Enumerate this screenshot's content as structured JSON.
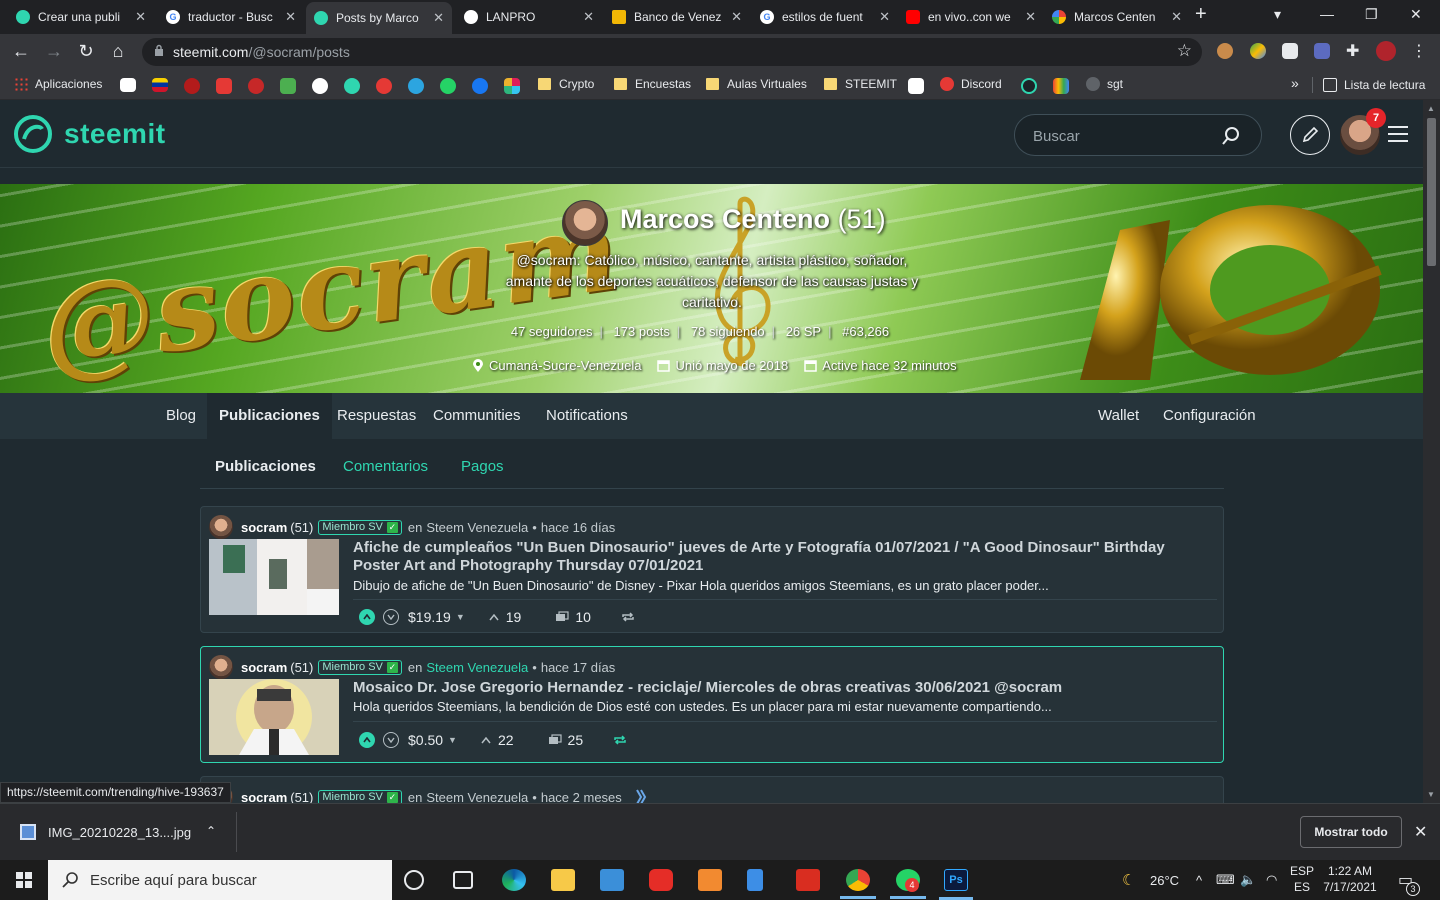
{
  "browser": {
    "tabs": [
      {
        "title": "Crear una publi",
        "fav_color": "#2fd6b0"
      },
      {
        "title": "traductor - Busc",
        "fav_color": "#ffffff"
      },
      {
        "title": "Posts by Marco",
        "fav_color": "#2fd6b0",
        "active": true
      },
      {
        "title": "LANPRO",
        "fav_color": "#ffffff"
      },
      {
        "title": "Banco de Venez",
        "fav_color": "#f2b705"
      },
      {
        "title": "estilos de fuent",
        "fav_color": "#ffffff"
      },
      {
        "title": "en vivo..con we",
        "fav_color": "#ff0000"
      },
      {
        "title": "Marcos Centen",
        "fav_color": "#fbbc04"
      }
    ],
    "new_tab_label": "+",
    "url_host": "steemit.com",
    "url_path": "/@socram/posts",
    "bookmarks": [
      {
        "label": "Aplicaciones"
      },
      {
        "label": "Crypto"
      },
      {
        "label": "Encuestas"
      },
      {
        "label": "Aulas Virtuales"
      },
      {
        "label": "STEEMIT"
      },
      {
        "label": "Discord"
      },
      {
        "label": "sgt"
      }
    ],
    "overflow_label": "»",
    "reading_list_label": "Lista de lectura"
  },
  "site": {
    "logo_text": "steemit",
    "search_placeholder": "Buscar",
    "notification_count": "7"
  },
  "profile": {
    "name": "Marcos Centeno",
    "reputation": "(51)",
    "bio": "@socram: Católico, músico, cantante, artista plástico, soñador, amante de los deportes acuáticos, defensor de las causas justas y caritativo.",
    "cover_text": "@socram",
    "stats": {
      "followers": "47 seguidores",
      "posts": "173 posts",
      "following": "78 siguiendo",
      "sp": "26 SP",
      "rank": "#63,266"
    },
    "location": "Cumaná-Sucre-Venezuela",
    "joined": "Unió mayo de 2018",
    "active": "Active hace 32 minutos"
  },
  "profile_nav": {
    "blog": "Blog",
    "posts": "Publicaciones",
    "replies": "Respuestas",
    "communities": "Communities",
    "notifications": "Notifications",
    "wallet": "Wallet",
    "settings": "Configuración"
  },
  "subtabs": {
    "posts": "Publicaciones",
    "comments": "Comentarios",
    "payouts": "Pagos"
  },
  "posts": [
    {
      "author": "socram",
      "rep": "(51)",
      "badge": "Miembro SV",
      "in": "en",
      "community": "Steem Venezuela",
      "time": "hace 16 días",
      "title": "Afiche de cumpleaños \"Un Buen Dinosaurio\" jueves de Arte y Fotografía 01/07/2021 / \"A Good Dinosaur\" Birthday Poster Art and Photography Thursday 07/01/2021",
      "desc": "Dibujo de afiche de \"Un Buen Dinosaurio\" de Disney - Pixar Hola queridos amigos Steemians, es un grato placer poder...",
      "payout": "$19.19",
      "votes": "19",
      "comments": "10"
    },
    {
      "author": "socram",
      "rep": "(51)",
      "badge": "Miembro SV",
      "in": "en",
      "community": "Steem Venezuela",
      "time": "hace 17 días",
      "title": "Mosaico Dr. Jose Gregorio Hernandez - reciclaje/ Miercoles de obras creativas 30/06/2021 @socram",
      "desc": "Hola queridos Steemians, la bendición de Dios esté con ustedes. Es un placer para mi estar nuevamente compartiendo...",
      "payout": "$0.50",
      "votes": "22",
      "comments": "25"
    },
    {
      "author": "socram",
      "rep": "(51)",
      "badge": "Miembro SV",
      "in": "en",
      "community": "Steem Venezuela",
      "time": "hace 2 meses"
    }
  ],
  "status_url": "https://steemit.com/trending/hive-193637",
  "downloads": {
    "file": "IMG_20210228_13....jpg",
    "show_all": "Mostrar todo"
  },
  "taskbar": {
    "search_placeholder": "Escribe aquí para buscar",
    "weather": "26°C",
    "lang_top": "ESP",
    "lang_bottom": "ES",
    "time": "1:22 AM",
    "date": "7/17/2021",
    "whatsapp_badge": "4",
    "notif_count": "3"
  },
  "colors": {
    "accent": "#2fd6b0",
    "background": "#1f2a30",
    "card": "#263238"
  }
}
